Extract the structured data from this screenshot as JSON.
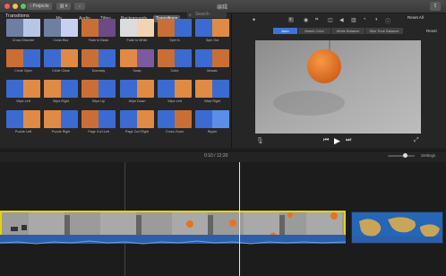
{
  "window": {
    "projects_label": "Projects",
    "title": "编辑"
  },
  "browser": {
    "tabs": [
      "My Media",
      "Audio",
      "Titles",
      "Backgrounds",
      "Transitions"
    ],
    "active_tab": "Transitions",
    "section_title": "Transitions",
    "search_placeholder": "Search",
    "transitions": [
      "Cross Dissolve",
      "Cross Blur",
      "Fade to Black",
      "Fade to White",
      "Spin In",
      "Spin Out",
      "Circle Open",
      "Circle Close",
      "Doorway",
      "Swap",
      "Cube",
      "Mosaic",
      "Wipe Left",
      "Wipe Right",
      "Wipe Up",
      "Wipe Down",
      "Wipe Left",
      "Wide Right",
      "Puzzle Left",
      "Puzzle Right",
      "Page Curl Left",
      "Page Curl Right",
      "Cross Zoom",
      "Ripple"
    ]
  },
  "viewer": {
    "reset_all": "Reset All",
    "reset": "Reset",
    "color_tabs": [
      "Auto",
      "Match Color",
      "White Balance",
      "Skin Tone Balance"
    ],
    "active_color_tab": "Auto"
  },
  "timeline": {
    "timecode": "0:10 / 12:20",
    "settings_label": "Settings",
    "zoom_level": 0.6
  },
  "colors": {
    "accent": "#3c74d6",
    "clip_border": "#e8d200",
    "orange_ball": "#e8731e"
  }
}
